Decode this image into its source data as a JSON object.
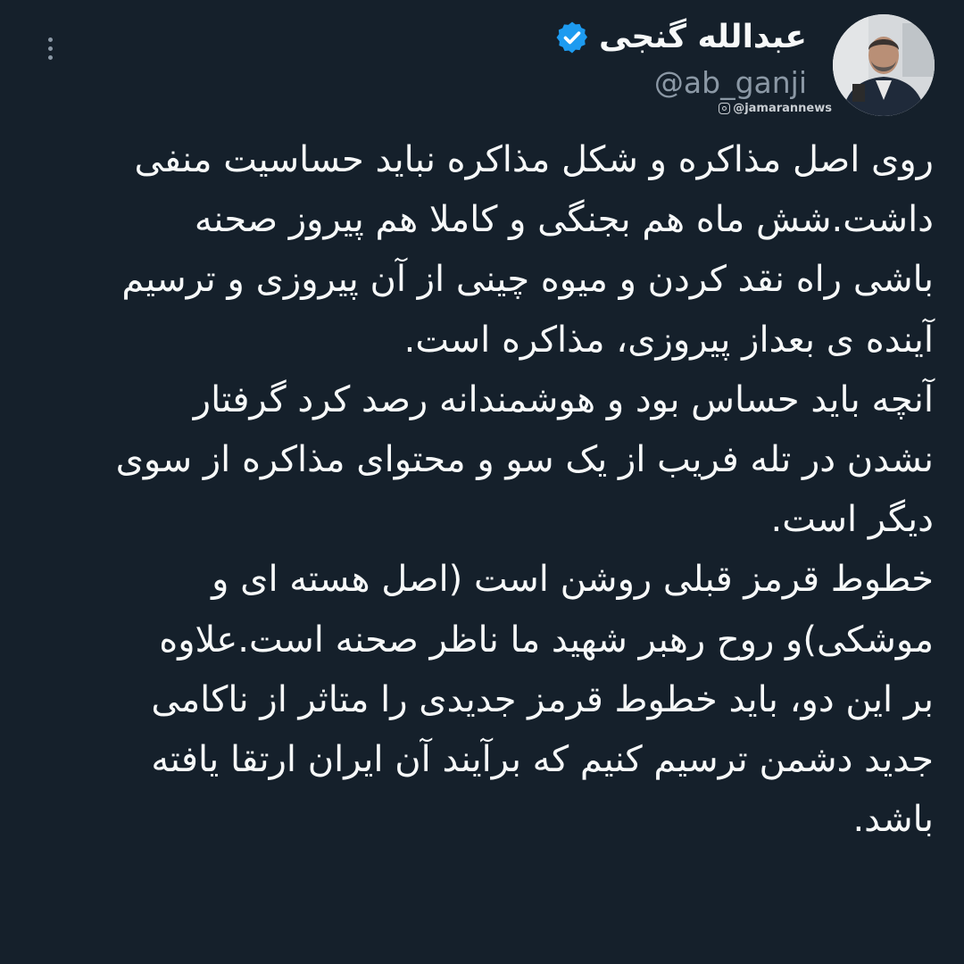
{
  "header": {
    "display_name": "عبدالله گنجی",
    "handle": "@ab_ganji",
    "verified": true
  },
  "watermark": "@jamarannews",
  "icons": {
    "more": "more-vertical-icon",
    "verified": "verified-badge-icon",
    "watermark": "instagram-icon"
  },
  "colors": {
    "background": "#15202b",
    "text": "#f7f9f9",
    "secondary": "#8b98a5",
    "verified": "#1d9bf0"
  },
  "tweet": {
    "lines": [
      "روی اصل مذاکره و شکل مذاکره نباید حساسیت منفی",
      "داشت.شش ماه هم بجنگی و کاملا هم پیروز صحنه",
      "باشی راه نقد کردن و میوه چینی از آن پیروزی و ترسیم",
      "آینده ی بعداز پیروزی، مذاکره است.",
      "آنچه باید حساس بود و هوشمندانه رصد کرد گرفتار",
      "نشدن در تله فریب از یک سو و محتوای مذاکره از سوی",
      "دیگر است.",
      "خطوط قرمز قبلی روشن است (اصل هسته ای و",
      "موشکی)و روح رهبر شهید ما ناظر صحنه است.علاوه",
      "بر این دو، باید خطوط قرمز جدیدی را متاثر از ناکامی",
      "جدید دشمن ترسیم کنیم که برآیند آن ایران ارتقا یافته",
      "باشد."
    ]
  }
}
